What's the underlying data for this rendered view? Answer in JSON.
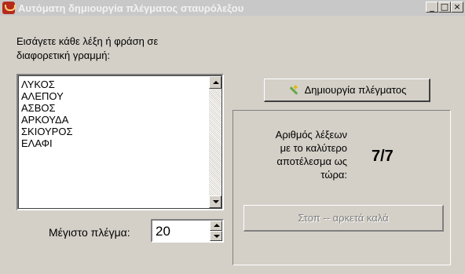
{
  "window": {
    "title": "Αυτόματη δημιουργία πλέγματος σταυρόλεξου",
    "controls": {
      "minimize": "_",
      "maximize": "□",
      "close": "×"
    }
  },
  "instructions": "Εισάγετε κάθε λέξη ή φράση σε διαφορετική γραμμή:",
  "word_list": [
    "ΛΥΚΟΣ",
    "ΑΛΕΠΟΥ",
    "ΑΣΒΟΣ",
    "ΑΡΚΟΥΔΑ",
    "ΣΚΙΟΥΡΟΣ",
    "ΕΛΑΦΙ"
  ],
  "max_grid": {
    "label": "Μέγιστο πλέγμα:",
    "value": "20"
  },
  "generate_button": {
    "label": "Δημιουργία πλέγματος",
    "icon": "magic-wand-icon"
  },
  "result": {
    "label_lines": [
      "Αριθμός λέξεων",
      "με το καλύτερο",
      "αποτέλεσμα ως",
      "τώρα:"
    ],
    "score": "7/7"
  },
  "stop_button": {
    "label": "Στοπ -- αρκετά καλά",
    "enabled": false
  }
}
